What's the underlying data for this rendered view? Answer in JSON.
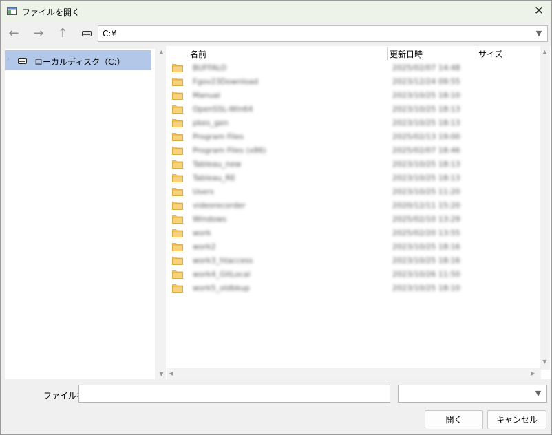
{
  "window": {
    "title": "ファイルを開く",
    "close_glyph": "✕"
  },
  "toolbar": {
    "back_glyph": "←",
    "forward_glyph": "→",
    "up_glyph": "↑"
  },
  "address": {
    "path": "C:¥",
    "dropdown_glyph": "▼"
  },
  "tree": {
    "chevron": "›",
    "items": [
      {
        "label": "ローカルディスク（C:）",
        "selected": true
      }
    ]
  },
  "list": {
    "columns": {
      "name": "名前",
      "modified": "更新日時",
      "size": "サイズ"
    },
    "scroll_up": "▲",
    "scroll_down": "▼",
    "scroll_left": "◀",
    "scroll_right": "▶",
    "items": [
      {
        "name": "BUFFALO",
        "modified": "2025/02/07 14:48"
      },
      {
        "name": "Fgov23Download",
        "modified": "2023/12/24 09:55"
      },
      {
        "name": "Manual",
        "modified": "2023/10/25 18:10"
      },
      {
        "name": "OpenSSL-Win64",
        "modified": "2023/10/25 18:13"
      },
      {
        "name": "pkes_gen",
        "modified": "2023/10/25 18:13"
      },
      {
        "name": "Program Files",
        "modified": "2025/02/13 19:00"
      },
      {
        "name": "Program Files (x86)",
        "modified": "2025/02/07 18:46"
      },
      {
        "name": "Tableau_new",
        "modified": "2023/10/25 18:13"
      },
      {
        "name": "Tableau_RE",
        "modified": "2023/10/25 18:13"
      },
      {
        "name": "Users",
        "modified": "2023/10/25 11:20"
      },
      {
        "name": "videorecorder",
        "modified": "2020/12/11 15:20"
      },
      {
        "name": "Windows",
        "modified": "2025/02/10 13:29"
      },
      {
        "name": "work",
        "modified": "2025/02/20 13:55"
      },
      {
        "name": "work2",
        "modified": "2023/10/25 18:16"
      },
      {
        "name": "work3_htaccess",
        "modified": "2023/10/25 18:16"
      },
      {
        "name": "work4_GitLocal",
        "modified": "2023/10/26 11:50"
      },
      {
        "name": "work5_oldbkup",
        "modified": "2023/10/25 18:10"
      }
    ]
  },
  "footer": {
    "filename_label": "ファイル名",
    "filename_value": "",
    "filetype_value": "",
    "filetype_dropdown_glyph": "▼",
    "open_label": "開く",
    "cancel_label": "キャンセル"
  },
  "colors": {
    "selection": "#b3c8e8",
    "folder": "#f4c760",
    "titlebar": "#eef3ea"
  }
}
